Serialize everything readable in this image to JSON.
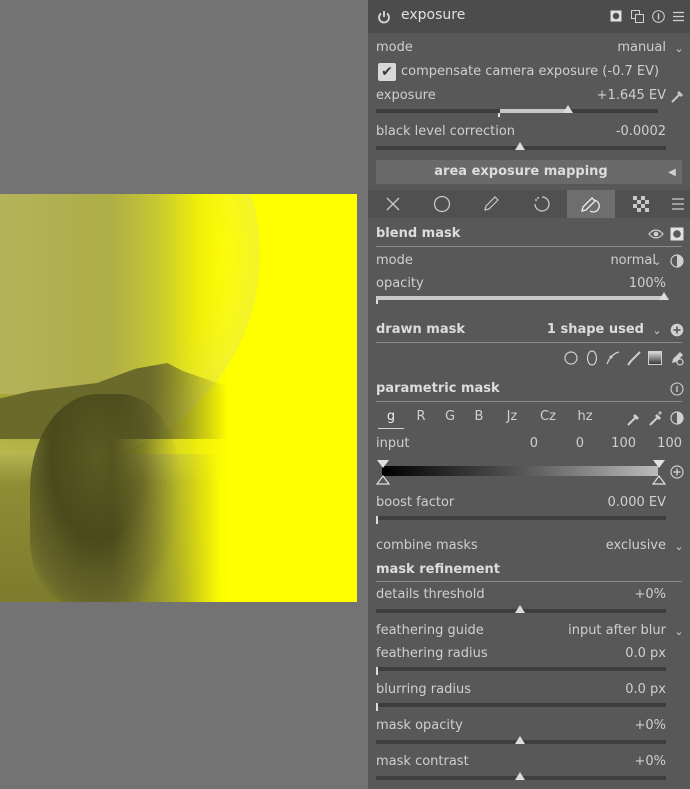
{
  "module": {
    "title": "exposure",
    "mode_label": "mode",
    "mode_value": "manual",
    "compensate_label": "compensate camera exposure (-0.7 EV)",
    "compensate_checked": true,
    "exposure_label": "exposure",
    "exposure_value": "+1.645 EV",
    "exposure_level": 0.62,
    "black_label": "black level correction",
    "black_value": "-0.0002",
    "area_button": "area exposure mapping"
  },
  "tabs": [
    {
      "icon": "off-icon",
      "glyph": "✕"
    },
    {
      "icon": "uniform-icon",
      "glyph": "○"
    },
    {
      "icon": "drawn-icon",
      "glyph": "✎"
    },
    {
      "icon": "parametric-icon",
      "glyph": "◔"
    },
    {
      "icon": "drawn-parametric-icon",
      "glyph": "✎"
    },
    {
      "icon": "raster-icon",
      "glyph": "▦"
    }
  ],
  "blend": {
    "title": "blend mask",
    "mode_label": "mode",
    "mode_value": "normal",
    "opacity_label": "opacity",
    "opacity_value": "100%",
    "opacity_level": 1.0
  },
  "drawn": {
    "title": "drawn mask",
    "shapes_value": "1 shape used"
  },
  "parametric": {
    "title": "parametric mask",
    "channels": [
      "g",
      "R",
      "G",
      "B",
      "Jz",
      "Cz",
      "hz"
    ],
    "active_channel": "g",
    "input_label": "input",
    "input_values": [
      "0",
      "0",
      "100",
      "100"
    ],
    "boost_label": "boost factor",
    "boost_value": "0.000 EV"
  },
  "combine": {
    "label": "combine masks",
    "value": "exclusive"
  },
  "refine": {
    "title": "mask refinement",
    "details_label": "details threshold",
    "details_value": "+0%",
    "guide_label": "feathering guide",
    "guide_value": "input after blur",
    "feather_label": "feathering radius",
    "feather_value": "0.0 px",
    "blur_label": "blurring radius",
    "blur_value": "0.0 px",
    "opacity_label": "mask opacity",
    "opacity_value": "+0%",
    "contrast_label": "mask contrast",
    "contrast_value": "+0%"
  },
  "colors": {
    "panel_bg": "#585858",
    "header_bg": "#4c4c4c",
    "image_yellow": "#ffff00"
  }
}
